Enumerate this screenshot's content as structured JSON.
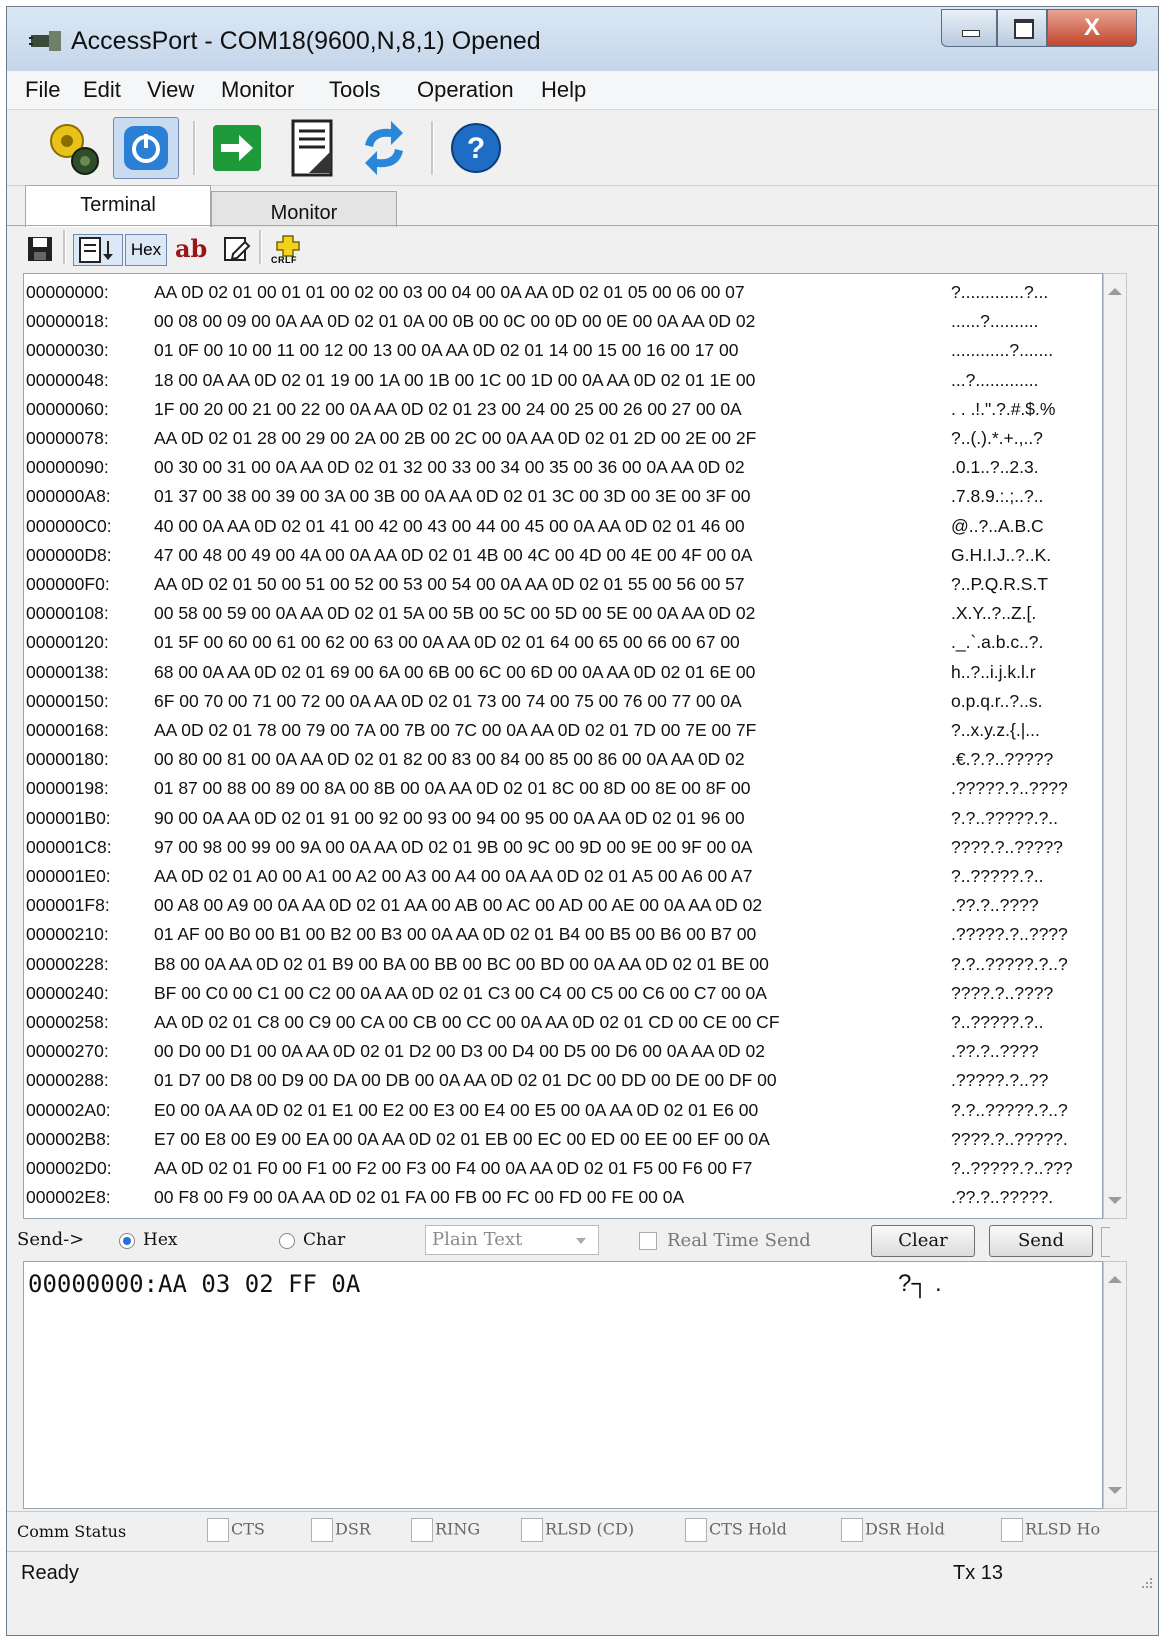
{
  "window": {
    "title": "AccessPort - COM18(9600,N,8,1) Opened",
    "close_glyph": "X"
  },
  "menu": {
    "items": [
      "File",
      "Edit",
      "View",
      "Monitor",
      "Tools",
      "Operation",
      "Help"
    ]
  },
  "toolbar": {
    "icons": [
      "settings-gears-icon",
      "power-icon",
      "arrow-right-icon",
      "document-icon",
      "refresh-arrows-icon",
      "help-icon"
    ]
  },
  "tabs": {
    "terminal": "Terminal",
    "monitor": "Monitor"
  },
  "subtoolbar": {
    "hex_label": "Hex",
    "ab_label": "ab",
    "crlf_label": "CRLF"
  },
  "hex_view": {
    "lines": [
      {
        "offset": "00000000:",
        "bytes": "AA 0D 02 01 00 01 01 00 02 00 03 00 04 00 0A AA 0D 02 01 05 00 06 00 07",
        "ascii": "?.............?..."
      },
      {
        "offset": "00000018:",
        "bytes": "00 08 00 09 00 0A AA 0D 02 01 0A 00 0B 00 0C 00 0D 00 0E 00 0A AA 0D 02",
        "ascii": "......?.........."
      },
      {
        "offset": "00000030:",
        "bytes": "01 0F 00 10 00 11 00 12 00 13 00 0A AA 0D 02 01 14 00 15 00 16 00 17 00",
        "ascii": "............?......."
      },
      {
        "offset": "00000048:",
        "bytes": "18 00 0A AA 0D 02 01 19 00 1A 00 1B 00 1C 00 1D 00 0A AA 0D 02 01 1E 00",
        "ascii": "...?............."
      },
      {
        "offset": "00000060:",
        "bytes": "1F 00 20 00 21 00 22 00 0A AA 0D 02 01 23 00 24 00 25 00 26 00 27 00 0A",
        "ascii": ". . .!.\".?.#.$.%"
      },
      {
        "offset": "00000078:",
        "bytes": "AA 0D 02 01 28 00 29 00 2A 00 2B 00 2C 00 0A AA 0D 02 01 2D 00 2E 00 2F",
        "ascii": "?..(.).*.+.,..?"
      },
      {
        "offset": "00000090:",
        "bytes": "00 30 00 31 00 0A AA 0D 02 01 32 00 33 00 34 00 35 00 36 00 0A AA 0D 02",
        "ascii": ".0.1..?..2.3."
      },
      {
        "offset": "000000A8:",
        "bytes": "01 37 00 38 00 39 00 3A 00 3B 00 0A AA 0D 02 01 3C 00 3D 00 3E 00 3F 00",
        "ascii": ".7.8.9.:.;..?.."
      },
      {
        "offset": "000000C0:",
        "bytes": "40 00 0A AA 0D 02 01 41 00 42 00 43 00 44 00 45 00 0A AA 0D 02 01 46 00",
        "ascii": "@..?..A.B.C"
      },
      {
        "offset": "000000D8:",
        "bytes": "47 00 48 00 49 00 4A 00 0A AA 0D 02 01 4B 00 4C 00 4D 00 4E 00 4F 00 0A",
        "ascii": "G.H.I.J..?..K."
      },
      {
        "offset": "000000F0:",
        "bytes": "AA 0D 02 01 50 00 51 00 52 00 53 00 54 00 0A AA 0D 02 01 55 00 56 00 57",
        "ascii": "?..P.Q.R.S.T"
      },
      {
        "offset": "00000108:",
        "bytes": "00 58 00 59 00 0A AA 0D 02 01 5A 00 5B 00 5C 00 5D 00 5E 00 0A AA 0D 02",
        "ascii": ".X.Y..?..Z.[."
      },
      {
        "offset": "00000120:",
        "bytes": "01 5F 00 60 00 61 00 62 00 63 00 0A AA 0D 02 01 64 00 65 00 66 00 67 00",
        "ascii": "._.`.a.b.c..?."
      },
      {
        "offset": "00000138:",
        "bytes": "68 00 0A AA 0D 02 01 69 00 6A 00 6B 00 6C 00 6D 00 0A AA 0D 02 01 6E 00",
        "ascii": "h..?..i.j.k.l.r"
      },
      {
        "offset": "00000150:",
        "bytes": "6F 00 70 00 71 00 72 00 0A AA 0D 02 01 73 00 74 00 75 00 76 00 77 00 0A",
        "ascii": "o.p.q.r..?..s."
      },
      {
        "offset": "00000168:",
        "bytes": "AA 0D 02 01 78 00 79 00 7A 00 7B 00 7C 00 0A AA 0D 02 01 7D 00 7E 00 7F",
        "ascii": "?..x.y.z.{.|..."
      },
      {
        "offset": "00000180:",
        "bytes": "00 80 00 81 00 0A AA 0D 02 01 82 00 83 00 84 00 85 00 86 00 0A AA 0D 02",
        "ascii": ".€.?.?..?????"
      },
      {
        "offset": "00000198:",
        "bytes": "01 87 00 88 00 89 00 8A 00 8B 00 0A AA 0D 02 01 8C 00 8D 00 8E 00 8F 00",
        "ascii": ".?????.?..????"
      },
      {
        "offset": "000001B0:",
        "bytes": "90 00 0A AA 0D 02 01 91 00 92 00 93 00 94 00 95 00 0A AA 0D 02 01 96 00",
        "ascii": "?.?..?????.?.."
      },
      {
        "offset": "000001C8:",
        "bytes": "97 00 98 00 99 00 9A 00 0A AA 0D 02 01 9B 00 9C 00 9D 00 9E 00 9F 00 0A",
        "ascii": "????.?..?????"
      },
      {
        "offset": "000001E0:",
        "bytes": "AA 0D 02 01 A0 00 A1 00 A2 00 A3 00 A4 00 0A AA 0D 02 01 A5 00 A6 00 A7",
        "ascii": "?..?????.?.."
      },
      {
        "offset": "000001F8:",
        "bytes": "00 A8 00 A9 00 0A AA 0D 02 01 AA 00 AB 00 AC 00 AD 00 AE 00 0A AA 0D 02",
        "ascii": ".??.?..????"
      },
      {
        "offset": "00000210:",
        "bytes": "01 AF 00 B0 00 B1 00 B2 00 B3 00 0A AA 0D 02 01 B4 00 B5 00 B6 00 B7 00",
        "ascii": ".?????.?..????"
      },
      {
        "offset": "00000228:",
        "bytes": "B8 00 0A AA 0D 02 01 B9 00 BA 00 BB 00 BC 00 BD 00 0A AA 0D 02 01 BE 00",
        "ascii": "?.?..?????.?..?"
      },
      {
        "offset": "00000240:",
        "bytes": "BF 00 C0 00 C1 00 C2 00 0A AA 0D 02 01 C3 00 C4 00 C5 00 C6 00 C7 00 0A",
        "ascii": "????.?..????"
      },
      {
        "offset": "00000258:",
        "bytes": "AA 0D 02 01 C8 00 C9 00 CA 00 CB 00 CC 00 0A AA 0D 02 01 CD 00 CE 00 CF",
        "ascii": "?..?????.?.."
      },
      {
        "offset": "00000270:",
        "bytes": "00 D0 00 D1 00 0A AA 0D 02 01 D2 00 D3 00 D4 00 D5 00 D6 00 0A AA 0D 02",
        "ascii": ".??.?..????"
      },
      {
        "offset": "00000288:",
        "bytes": "01 D7 00 D8 00 D9 00 DA 00 DB 00 0A AA 0D 02 01 DC 00 DD 00 DE 00 DF 00",
        "ascii": ".?????.?..??"
      },
      {
        "offset": "000002A0:",
        "bytes": "E0 00 0A AA 0D 02 01 E1 00 E2 00 E3 00 E4 00 E5 00 0A AA 0D 02 01 E6 00",
        "ascii": "?.?..?????.?..?"
      },
      {
        "offset": "000002B8:",
        "bytes": "E7 00 E8 00 E9 00 EA 00 0A AA 0D 02 01 EB 00 EC 00 ED 00 EE 00 EF 00 0A",
        "ascii": "????.?..?????."
      },
      {
        "offset": "000002D0:",
        "bytes": "AA 0D 02 01 F0 00 F1 00 F2 00 F3 00 F4 00 0A AA 0D 02 01 F5 00 F6 00 F7",
        "ascii": "?..?????.?..???"
      },
      {
        "offset": "000002E8:",
        "bytes": "00 F8 00 F9 00 0A AA 0D 02 01 FA 00 FB 00 FC 00 FD 00 FE 00 0A",
        "ascii": ".??.?..?????."
      }
    ]
  },
  "send_bar": {
    "label": "Send->",
    "hex_option": "Hex",
    "char_option": "Char",
    "selected_mode": "Hex",
    "format_select": "Plain Text",
    "realtime_label": "Real Time Send",
    "realtime_checked": false,
    "clear_label": "Clear",
    "send_label": "Send"
  },
  "send_input": {
    "text": "00000000:AA 03 02 FF 0A",
    "ascii": "?┐  ."
  },
  "comm_status": {
    "label": "Comm Status",
    "flags": [
      "CTS",
      "DSR",
      "RING",
      "RLSD (CD)",
      "CTS Hold",
      "DSR Hold",
      "RLSD Ho"
    ]
  },
  "status_bar": {
    "state": "Ready",
    "tx": "Tx 13"
  },
  "colors": {
    "title_gradient_top": "#dbe7f4",
    "close_button": "#c2442c",
    "radio_selected": "#2a6fd6"
  }
}
